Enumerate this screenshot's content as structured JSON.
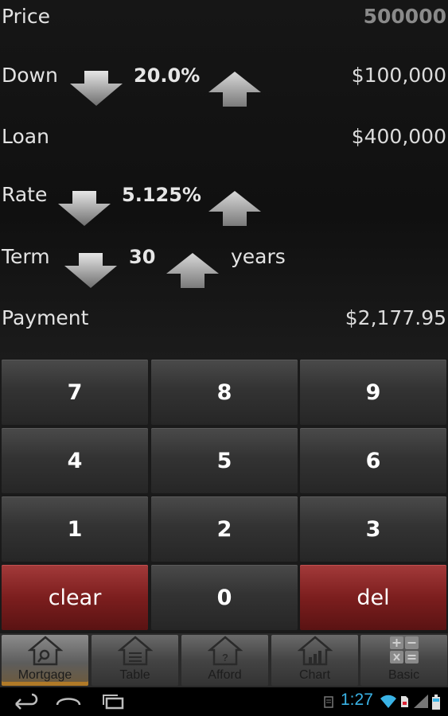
{
  "calculator": {
    "price": {
      "label": "Price",
      "value": "500000"
    },
    "down": {
      "label": "Down",
      "percent": "20.0%",
      "value": "$100,000"
    },
    "loan": {
      "label": "Loan",
      "value": "$400,000"
    },
    "rate": {
      "label": "Rate",
      "percent": "5.125%"
    },
    "term": {
      "label": "Term",
      "value": "30",
      "unit": "years"
    },
    "payment": {
      "label": "Payment",
      "value": "$2,177.95"
    }
  },
  "keypad": {
    "keys": [
      "7",
      "8",
      "9",
      "4",
      "5",
      "6",
      "1",
      "2",
      "3"
    ],
    "clear_label": "clear",
    "zero_label": "0",
    "del_label": "del"
  },
  "tabs": [
    {
      "label": "Mortgage",
      "icon": "house-magnifier-icon",
      "active": true
    },
    {
      "label": "Table",
      "icon": "house-table-icon",
      "active": false
    },
    {
      "label": "Afford",
      "icon": "house-question-icon",
      "active": false
    },
    {
      "label": "Chart",
      "icon": "house-chart-icon",
      "active": false
    },
    {
      "label": "Basic",
      "icon": "calculator-icon",
      "active": false
    }
  ],
  "system_bar": {
    "time": "1:27",
    "icons": [
      "back-icon",
      "home-icon",
      "recent-apps-icon",
      "wifi-icon",
      "sd-card-icon",
      "signal-icon",
      "battery-icon"
    ]
  },
  "colors": {
    "background": "#101010",
    "key_dark": "#333333",
    "key_red": "#7c1e1e",
    "active_tab_accent": "#b07a28",
    "clock": "#3ab3e6"
  }
}
